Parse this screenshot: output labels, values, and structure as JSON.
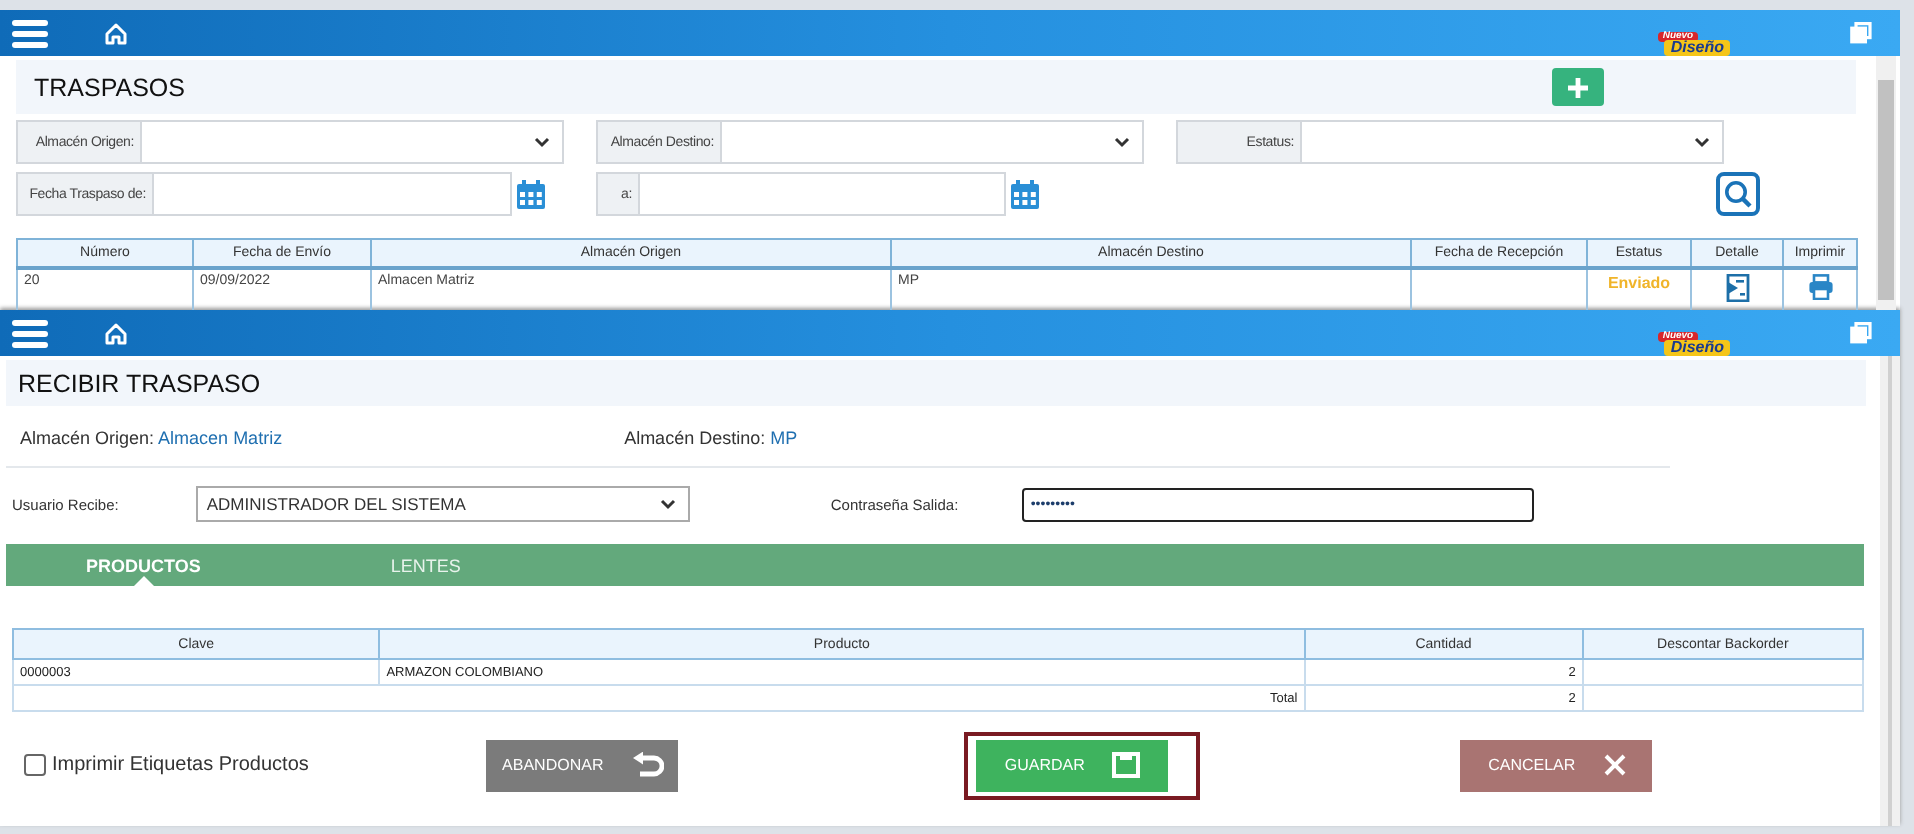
{
  "back_window": {
    "logo": {
      "top": "Nuevo",
      "bottom": "Diseño"
    },
    "title": "TRASPASOS",
    "filters": [
      {
        "label": "Almacén Origen:",
        "kind": "select"
      },
      {
        "label": "Almacén Destino:",
        "kind": "select"
      },
      {
        "label": "Estatus:",
        "kind": "select"
      },
      {
        "label": "Fecha Traspaso de:",
        "kind": "date"
      },
      {
        "label": "a:",
        "kind": "date"
      }
    ],
    "table": {
      "columns": [
        "Número",
        "Fecha de Envío",
        "Almacén Origen",
        "Almacén Destino",
        "Fecha de Recepción",
        "Estatus",
        "Detalle",
        "Imprimir"
      ],
      "rows": [
        {
          "number": "20",
          "sent_date": "09/09/2022",
          "origin": "Almacen Matriz",
          "destination": "MP",
          "status": "Enviado"
        }
      ]
    }
  },
  "modal": {
    "logo": {
      "top": "Nuevo",
      "bottom": "Diseño"
    },
    "title": "RECIBIR TRASPASO",
    "origin": {
      "label": "Almacén Origen:",
      "value": "Almacen Matriz"
    },
    "destination": {
      "label": "Almacén Destino:",
      "value": "MP"
    },
    "user": {
      "label": "Usuario Recibe:",
      "value": "ADMINISTRADOR DEL SISTEMA"
    },
    "password": {
      "label": "Contraseña Salida:",
      "value": "•••••••••"
    },
    "tabs": [
      {
        "label": "PRODUCTOS",
        "selected": true
      },
      {
        "label": "LENTES",
        "selected": false
      }
    ],
    "table": {
      "columns": [
        "Clave",
        "Producto",
        "Cantidad",
        "Descontar Backorder"
      ],
      "rows": [
        {
          "code": "0000003",
          "product": "ARMAZON COLOMBIANO",
          "quantity": "2"
        }
      ],
      "total": {
        "label": "Total",
        "value": "2"
      }
    },
    "print_labels": {
      "label": "Imprimir Etiquetas Productos",
      "checked": false
    },
    "buttons": [
      {
        "label": "ABANDONAR",
        "kind": "abandon",
        "focused": false
      },
      {
        "label": "GUARDAR",
        "kind": "save",
        "focused": true
      },
      {
        "label": "CANCELAR",
        "kind": "cancel",
        "focused": false
      }
    ]
  }
}
